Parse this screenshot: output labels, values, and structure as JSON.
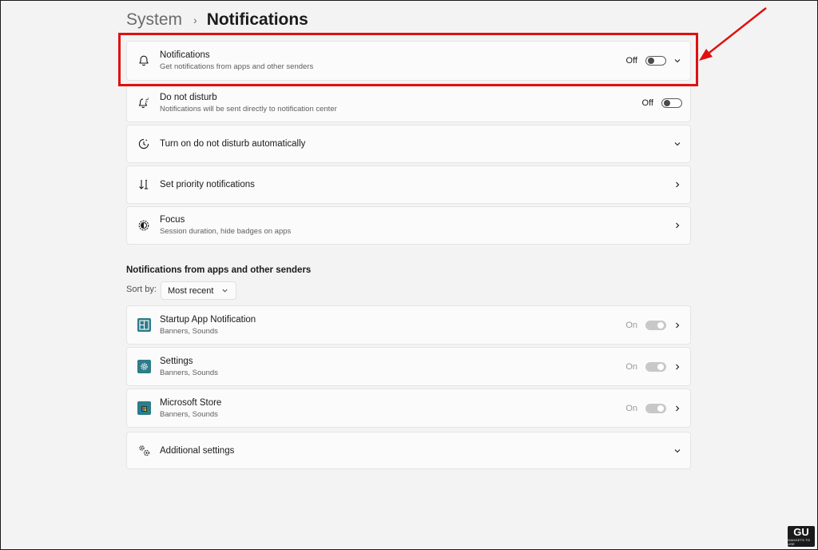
{
  "breadcrumb": {
    "parent": "System",
    "separator": "›",
    "title": "Notifications"
  },
  "settings": [
    {
      "id": "notifications",
      "icon": "bell-icon",
      "title": "Notifications",
      "subtitle": "Get notifications from apps and other senders",
      "toggle_label": "Off",
      "toggle_state": "off"
    },
    {
      "id": "do-not-disturb",
      "icon": "do-not-disturb-icon",
      "title": "Do not disturb",
      "subtitle": "Notifications will be sent directly to notification center",
      "toggle_label": "Off",
      "toggle_state": "off"
    },
    {
      "id": "dnd-auto",
      "icon": "clock-icon",
      "title": "Turn on do not disturb automatically"
    },
    {
      "id": "priority",
      "icon": "priority-arrows-icon",
      "title": "Set priority notifications"
    },
    {
      "id": "focus",
      "icon": "focus-icon",
      "title": "Focus",
      "subtitle": "Session duration, hide badges on apps"
    }
  ],
  "apps_section": {
    "heading": "Notifications from apps and other senders",
    "sort_label": "Sort by:",
    "sort_value": "Most recent",
    "apps": [
      {
        "icon": "startup-app-icon",
        "name": "Startup App Notification",
        "detail": "Banners, Sounds",
        "toggle_label": "On",
        "toggle_state": "on"
      },
      {
        "icon": "settings-app-icon",
        "name": "Settings",
        "detail": "Banners, Sounds",
        "toggle_label": "On",
        "toggle_state": "on"
      },
      {
        "icon": "microsoft-store-icon",
        "name": "Microsoft Store",
        "detail": "Banners, Sounds",
        "toggle_label": "On",
        "toggle_state": "on"
      }
    ],
    "additional": {
      "icon": "gears-icon",
      "title": "Additional settings"
    }
  },
  "colors": {
    "highlight": "#e01010",
    "app_icon_teal": "#2d7d8a",
    "toggle_disabled": "#c8c8c8"
  },
  "watermark": "GADGETS TO USE"
}
